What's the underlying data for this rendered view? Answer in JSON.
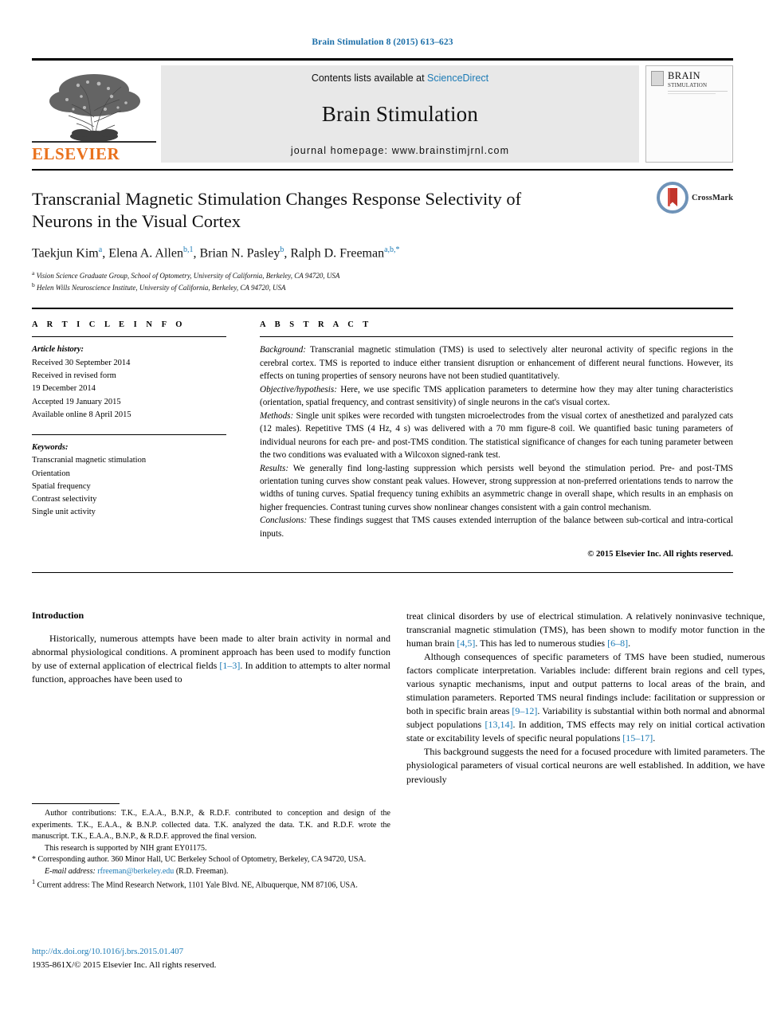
{
  "running_head": "Brain Stimulation 8 (2015) 613–623",
  "masthead": {
    "contents_prefix": "Contents lists available at ",
    "sciencedirect": "ScienceDirect",
    "journal_title": "Brain Stimulation",
    "homepage": "journal homepage: www.brainstimjrnl.com",
    "publisher_wordmark": "ELSEVIER",
    "cover": {
      "line1": "BRAIN",
      "line2": "STIMULATION",
      "corner_note": ""
    }
  },
  "article": {
    "title": "Transcranial Magnetic Stimulation Changes Response Selectivity of Neurons in the Visual Cortex",
    "authors_html": "Taekjun Kim a, Elena A. Allen b,1, Brian N. Pasley b, Ralph D. Freeman a,b,*",
    "authors": [
      {
        "name": "Taekjun Kim",
        "marks": "a"
      },
      {
        "name": "Elena A. Allen",
        "marks": "b,1"
      },
      {
        "name": "Brian N. Pasley",
        "marks": "b"
      },
      {
        "name": "Ralph D. Freeman",
        "marks": "a,b,*"
      }
    ],
    "affiliations": [
      {
        "mark": "a",
        "text": "Vision Science Graduate Group, School of Optometry, University of California, Berkeley, CA 94720, USA"
      },
      {
        "mark": "b",
        "text": "Helen Wills Neuroscience Institute, University of California, Berkeley, CA 94720, USA"
      }
    ],
    "crossmark_label": "CrossMark"
  },
  "article_info": {
    "heading": "A R T I C L E   I N F O",
    "history_label": "Article history:",
    "history": [
      "Received 30 September 2014",
      "Received in revised form",
      "19 December 2014",
      "Accepted 19 January 2015",
      "Available online 8 April 2015"
    ],
    "keywords_label": "Keywords:",
    "keywords": [
      "Transcranial magnetic stimulation",
      "Orientation",
      "Spatial frequency",
      "Contrast selectivity",
      "Single unit activity"
    ]
  },
  "abstract": {
    "heading": "A B S T R A C T",
    "sections": [
      {
        "label": "Background:",
        "text": " Transcranial magnetic stimulation (TMS) is used to selectively alter neuronal activity of specific regions in the cerebral cortex. TMS is reported to induce either transient disruption or enhancement of different neural functions. However, its effects on tuning properties of sensory neurons have not been studied quantitatively."
      },
      {
        "label": "Objective/hypothesis:",
        "text": " Here, we use specific TMS application parameters to determine how they may alter tuning characteristics (orientation, spatial frequency, and contrast sensitivity) of single neurons in the cat's visual cortex."
      },
      {
        "label": "Methods:",
        "text": " Single unit spikes were recorded with tungsten microelectrodes from the visual cortex of anesthetized and paralyzed cats (12 males). Repetitive TMS (4 Hz, 4 s) was delivered with a 70 mm figure-8 coil. We quantified basic tuning parameters of individual neurons for each pre- and post-TMS condition. The statistical significance of changes for each tuning parameter between the two conditions was evaluated with a Wilcoxon signed-rank test."
      },
      {
        "label": "Results:",
        "text": " We generally find long-lasting suppression which persists well beyond the stimulation period. Pre- and post-TMS orientation tuning curves show constant peak values. However, strong suppression at non-preferred orientations tends to narrow the widths of tuning curves. Spatial frequency tuning exhibits an asymmetric change in overall shape, which results in an emphasis on higher frequencies. Contrast tuning curves show nonlinear changes consistent with a gain control mechanism."
      },
      {
        "label": "Conclusions:",
        "text": " These findings suggest that TMS causes extended interruption of the balance between sub-cortical and intra-cortical inputs."
      }
    ],
    "copyright": "© 2015 Elsevier Inc. All rights reserved."
  },
  "introduction": {
    "heading": "Introduction",
    "left_paragraphs": [
      {
        "parts": [
          {
            "t": "Historically, numerous attempts have been made to alter brain activity in normal and abnormal physiological conditions. A prominent approach has been used to modify function by use of external application of electrical fields "
          },
          {
            "t": "[1–3]",
            "ref": true
          },
          {
            "t": ". In addition to attempts to alter normal function, approaches have been used to"
          }
        ]
      }
    ],
    "right_paragraphs": [
      {
        "indent": false,
        "parts": [
          {
            "t": "treat clinical disorders by use of electrical stimulation. A relatively noninvasive technique, transcranial magnetic stimulation (TMS), has been shown to modify motor function in the human brain "
          },
          {
            "t": "[4,5]",
            "ref": true
          },
          {
            "t": ". This has led to numerous studies "
          },
          {
            "t": "[6–8]",
            "ref": true
          },
          {
            "t": "."
          }
        ]
      },
      {
        "indent": true,
        "parts": [
          {
            "t": "Although consequences of specific parameters of TMS have been studied, numerous factors complicate interpretation. Variables include: different brain regions and cell types, various synaptic mechanisms, input and output patterns to local areas of the brain, and stimulation parameters. Reported TMS neural findings include: facilitation or suppression or both in specific brain areas "
          },
          {
            "t": "[9–12]",
            "ref": true
          },
          {
            "t": ". Variability is substantial within both normal and abnormal subject populations "
          },
          {
            "t": "[13,14]",
            "ref": true
          },
          {
            "t": ". In addition, TMS effects may rely on initial cortical activation state or excitability levels of specific neural populations "
          },
          {
            "t": "[15–17]",
            "ref": true
          },
          {
            "t": "."
          }
        ]
      },
      {
        "indent": true,
        "parts": [
          {
            "t": "This background suggests the need for a focused procedure with limited parameters. The physiological parameters of visual cortical neurons are well established. In addition, we have previously"
          }
        ]
      }
    ]
  },
  "footnotes": [
    {
      "indent": true,
      "text": "Author contributions: T.K., E.A.A., B.N.P., & R.D.F. contributed to conception and design of the experiments. T.K., E.A.A., & B.N.P. collected data. T.K. analyzed the data. T.K. and R.D.F. wrote the manuscript. T.K., E.A.A., B.N.P., & R.D.F. approved the final version."
    },
    {
      "indent": true,
      "text": "This research is supported by NIH grant EY01175."
    },
    {
      "indent": false,
      "marker": "*",
      "text": " Corresponding author. 360 Minor Hall, UC Berkeley School of Optometry, Berkeley, CA 94720, USA."
    },
    {
      "indent": true,
      "email_label": "E-mail address:",
      "email": "rfreeman@berkeley.edu",
      "email_tail": " (R.D. Freeman)."
    },
    {
      "indent": false,
      "marker": "1",
      "text": " Current address: The Mind Research Network, 1101 Yale Blvd. NE, Albuquerque, NM 87106, USA."
    }
  ],
  "footer": {
    "doi": "http://dx.doi.org/10.1016/j.brs.2015.01.407",
    "issn": "1935-861X/© 2015 Elsevier Inc. All rights reserved."
  },
  "colors": {
    "link": "#1b7ab5",
    "running_head": "#1b6ea8",
    "elsevier_orange": "#E9711C",
    "masthead_grey": "#e8e8e8",
    "crossmark_red": "#c2352b",
    "crossmark_blue": "#6f93b8"
  }
}
